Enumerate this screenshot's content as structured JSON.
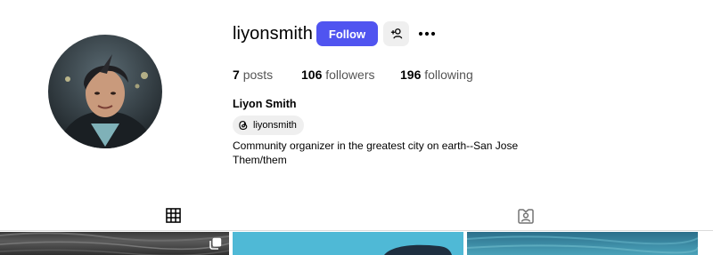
{
  "profile": {
    "username": "liyonsmith",
    "follow_label": "Follow",
    "full_name": "Liyon Smith",
    "threads_handle": "liyonsmith",
    "bio": [
      "Community organizer in the greatest city on earth--San Jose",
      "Them/them"
    ]
  },
  "stats": {
    "posts_count": "7",
    "posts_label": "posts",
    "followers_count": "106",
    "followers_label": "followers",
    "following_count": "196",
    "following_label": "following"
  },
  "tabs": [
    {
      "icon": "grid-icon",
      "selected": true
    },
    {
      "icon": "tagged-icon",
      "selected": false
    }
  ],
  "colors": {
    "follow_button": "#5054f0",
    "secondary_button": "#efefef",
    "muted_text": "#555555"
  }
}
